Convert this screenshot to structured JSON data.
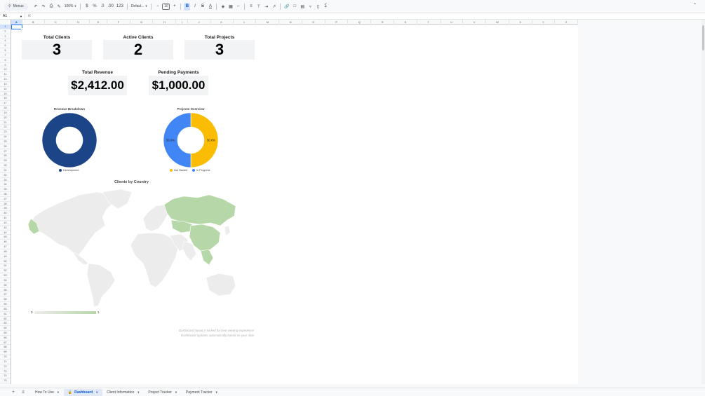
{
  "toolbar": {
    "menus_label": "Menus",
    "zoom": "100%",
    "currency": "$",
    "percent": "%",
    "decrease_decimals": ".0",
    "increase_decimals": ".00",
    "more_formats": "123",
    "font_name": "Defaul...",
    "font_size": "10"
  },
  "formula_bar": {
    "cell_ref": "A1",
    "fx": "fx"
  },
  "columns": [
    "A",
    "B",
    "C",
    "D",
    "E",
    "F",
    "G",
    "H",
    "I",
    "J",
    "K",
    "L",
    "M",
    "N",
    "O",
    "P",
    "Q",
    "R",
    "S",
    "T",
    "U",
    "V",
    "W",
    "X",
    "Y",
    "Z"
  ],
  "rows_count": 75,
  "kpis": {
    "total_clients": {
      "label": "Total Clients",
      "value": "3"
    },
    "active_clients": {
      "label": "Active Clients",
      "value": "2"
    },
    "total_projects": {
      "label": "Total Projects",
      "value": "3"
    },
    "total_revenue": {
      "label": "Total Revenue",
      "value": "$2,412.00"
    },
    "pending_payments": {
      "label": "Pending Payments",
      "value": "$1,000.00"
    }
  },
  "chart_data": [
    {
      "type": "pie",
      "title": "Revenue Breakdown",
      "categories": [
        "Development"
      ],
      "values": [
        100
      ],
      "colors": [
        "#1c4587"
      ]
    },
    {
      "type": "pie",
      "title": "Projects Overview",
      "categories": [
        "Not Started",
        "In Progress"
      ],
      "values": [
        50,
        50
      ],
      "data_labels": [
        "50.0%",
        "50.0%"
      ],
      "colors": [
        "#fbbc04",
        "#4285f4"
      ]
    }
  ],
  "geo_chart": {
    "title": "Clients by Country",
    "scale_min": "0",
    "scale_max": "1",
    "highlight_color": "#b6d7a8",
    "base_color": "#ececec"
  },
  "notes": {
    "line1": "Dashboard layout is locked for best viewing experience",
    "line2": "Dashboard updates automatically based on your data"
  },
  "sheet_tabs": [
    {
      "label": "How To Use",
      "active": false
    },
    {
      "label": "Dashboard",
      "active": true
    },
    {
      "label": "Client Information",
      "active": false
    },
    {
      "label": "Project Tracker",
      "active": false
    },
    {
      "label": "Payment Tracker",
      "active": false
    }
  ]
}
